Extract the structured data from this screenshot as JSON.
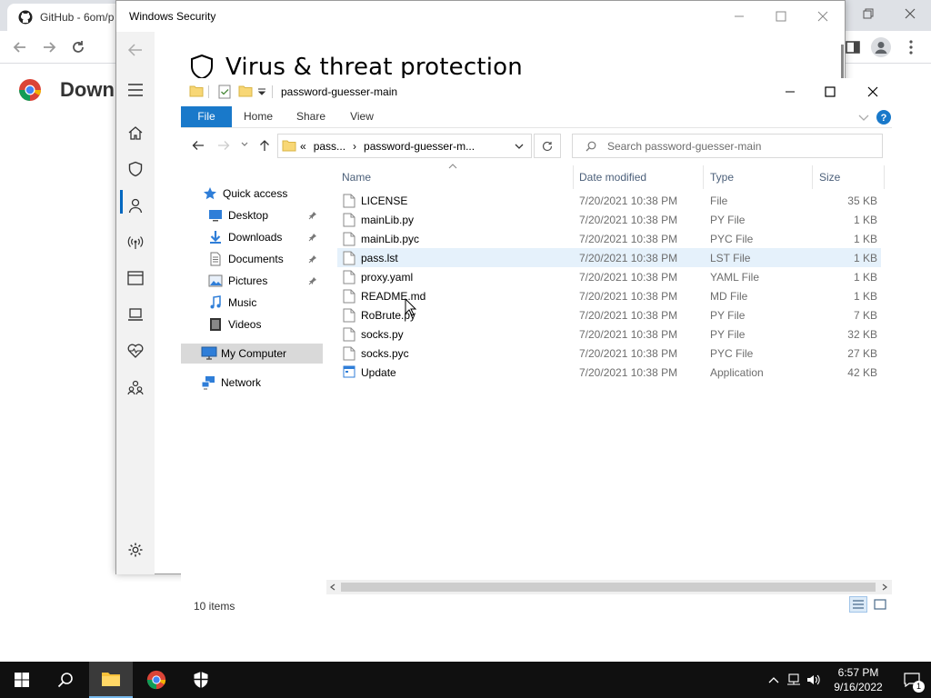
{
  "chrome": {
    "tab_title": "GitHub - 6om/p",
    "page_heading": "Downl"
  },
  "winsec": {
    "title": "Windows Security",
    "heading": "Virus & threat protection",
    "nav_icons": [
      "menu-icon",
      "home-icon",
      "shield-icon",
      "account-icon",
      "network-icon",
      "app-browser-icon",
      "device-security-icon",
      "health-icon",
      "family-icon",
      "settings-icon"
    ]
  },
  "explorer": {
    "path_title": "password-guesser-main",
    "ribbon_tabs": [
      "File",
      "Home",
      "Share",
      "View"
    ],
    "breadcrumb": {
      "prefix": "«",
      "parent": "pass...",
      "sep": "›",
      "current": "password-guesser-m..."
    },
    "search_placeholder": "Search password-guesser-main",
    "nav": [
      {
        "label": "Quick access",
        "icon": "star-icon",
        "pinned": false
      },
      {
        "label": "Desktop",
        "icon": "desktop-icon",
        "pinned": true
      },
      {
        "label": "Downloads",
        "icon": "downloads-icon",
        "pinned": true
      },
      {
        "label": "Documents",
        "icon": "documents-icon",
        "pinned": true
      },
      {
        "label": "Pictures",
        "icon": "pictures-icon",
        "pinned": true
      },
      {
        "label": "Music",
        "icon": "music-icon",
        "pinned": false
      },
      {
        "label": "Videos",
        "icon": "videos-icon",
        "pinned": false
      },
      {
        "label": "My Computer",
        "icon": "computer-icon",
        "pinned": false,
        "selected": true
      },
      {
        "label": "Network",
        "icon": "network-icon",
        "pinned": false
      }
    ],
    "columns": {
      "name": "Name",
      "date": "Date modified",
      "type": "Type",
      "size": "Size"
    },
    "files": [
      {
        "name": "LICENSE",
        "date": "7/20/2021 10:38 PM",
        "type": "File",
        "size": "35 KB"
      },
      {
        "name": "mainLib.py",
        "date": "7/20/2021 10:38 PM",
        "type": "PY File",
        "size": "1 KB"
      },
      {
        "name": "mainLib.pyc",
        "date": "7/20/2021 10:38 PM",
        "type": "PYC File",
        "size": "1 KB"
      },
      {
        "name": "pass.lst",
        "date": "7/20/2021 10:38 PM",
        "type": "LST File",
        "size": "1 KB",
        "selected": true
      },
      {
        "name": "proxy.yaml",
        "date": "7/20/2021 10:38 PM",
        "type": "YAML File",
        "size": "1 KB"
      },
      {
        "name": "README.md",
        "date": "7/20/2021 10:38 PM",
        "type": "MD File",
        "size": "1 KB"
      },
      {
        "name": "RoBrute.py",
        "date": "7/20/2021 10:38 PM",
        "type": "PY File",
        "size": "7 KB"
      },
      {
        "name": "socks.py",
        "date": "7/20/2021 10:38 PM",
        "type": "PY File",
        "size": "32 KB"
      },
      {
        "name": "socks.pyc",
        "date": "7/20/2021 10:38 PM",
        "type": "PYC File",
        "size": "27 KB"
      },
      {
        "name": "Update",
        "date": "7/20/2021 10:38 PM",
        "type": "Application",
        "size": "42 KB"
      }
    ],
    "status": "10 items"
  },
  "taskbar": {
    "time": "6:57 PM",
    "date": "9/16/2022",
    "notifications": "1"
  },
  "colors": {
    "accent": "#0067c0",
    "file_tab": "#1979ca",
    "selection": "#e5f1fb",
    "taskbar": "#101010"
  }
}
